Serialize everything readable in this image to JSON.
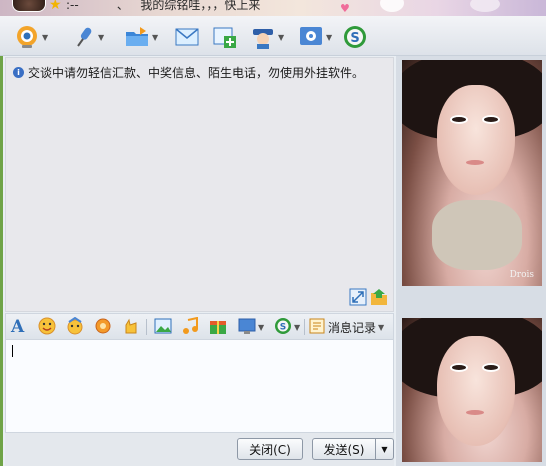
{
  "window": {
    "title": "我的综铭哇，，，快上来",
    "separator": "、"
  },
  "top_toolbar": {
    "items": [
      {
        "name": "video-call",
        "icon": "webcam-icon"
      },
      {
        "name": "voice-call",
        "icon": "microphone-icon"
      },
      {
        "name": "send-file",
        "icon": "folder-icon"
      },
      {
        "name": "send-email",
        "icon": "mail-icon"
      },
      {
        "name": "create-group",
        "icon": "add-group-icon"
      },
      {
        "name": "remote-assist",
        "icon": "assistant-icon"
      },
      {
        "name": "app-settings",
        "icon": "apps-icon"
      },
      {
        "name": "soso",
        "icon": "soso-icon"
      }
    ]
  },
  "chat": {
    "notice": "交谈中请勿轻信汇款、中奖信息、陌生电话，勿使用外挂软件。"
  },
  "input_toolbar": {
    "font_icon_label": "A",
    "history_label": "消息记录"
  },
  "buttons": {
    "close": "关闭(C)",
    "send": "发送(S)"
  },
  "photos": {
    "signature": "Drois"
  },
  "colors": {
    "accent": "#3a6fc4",
    "toolbar_bg": "#dde2e9",
    "chat_bg": "#e8e8ec"
  }
}
